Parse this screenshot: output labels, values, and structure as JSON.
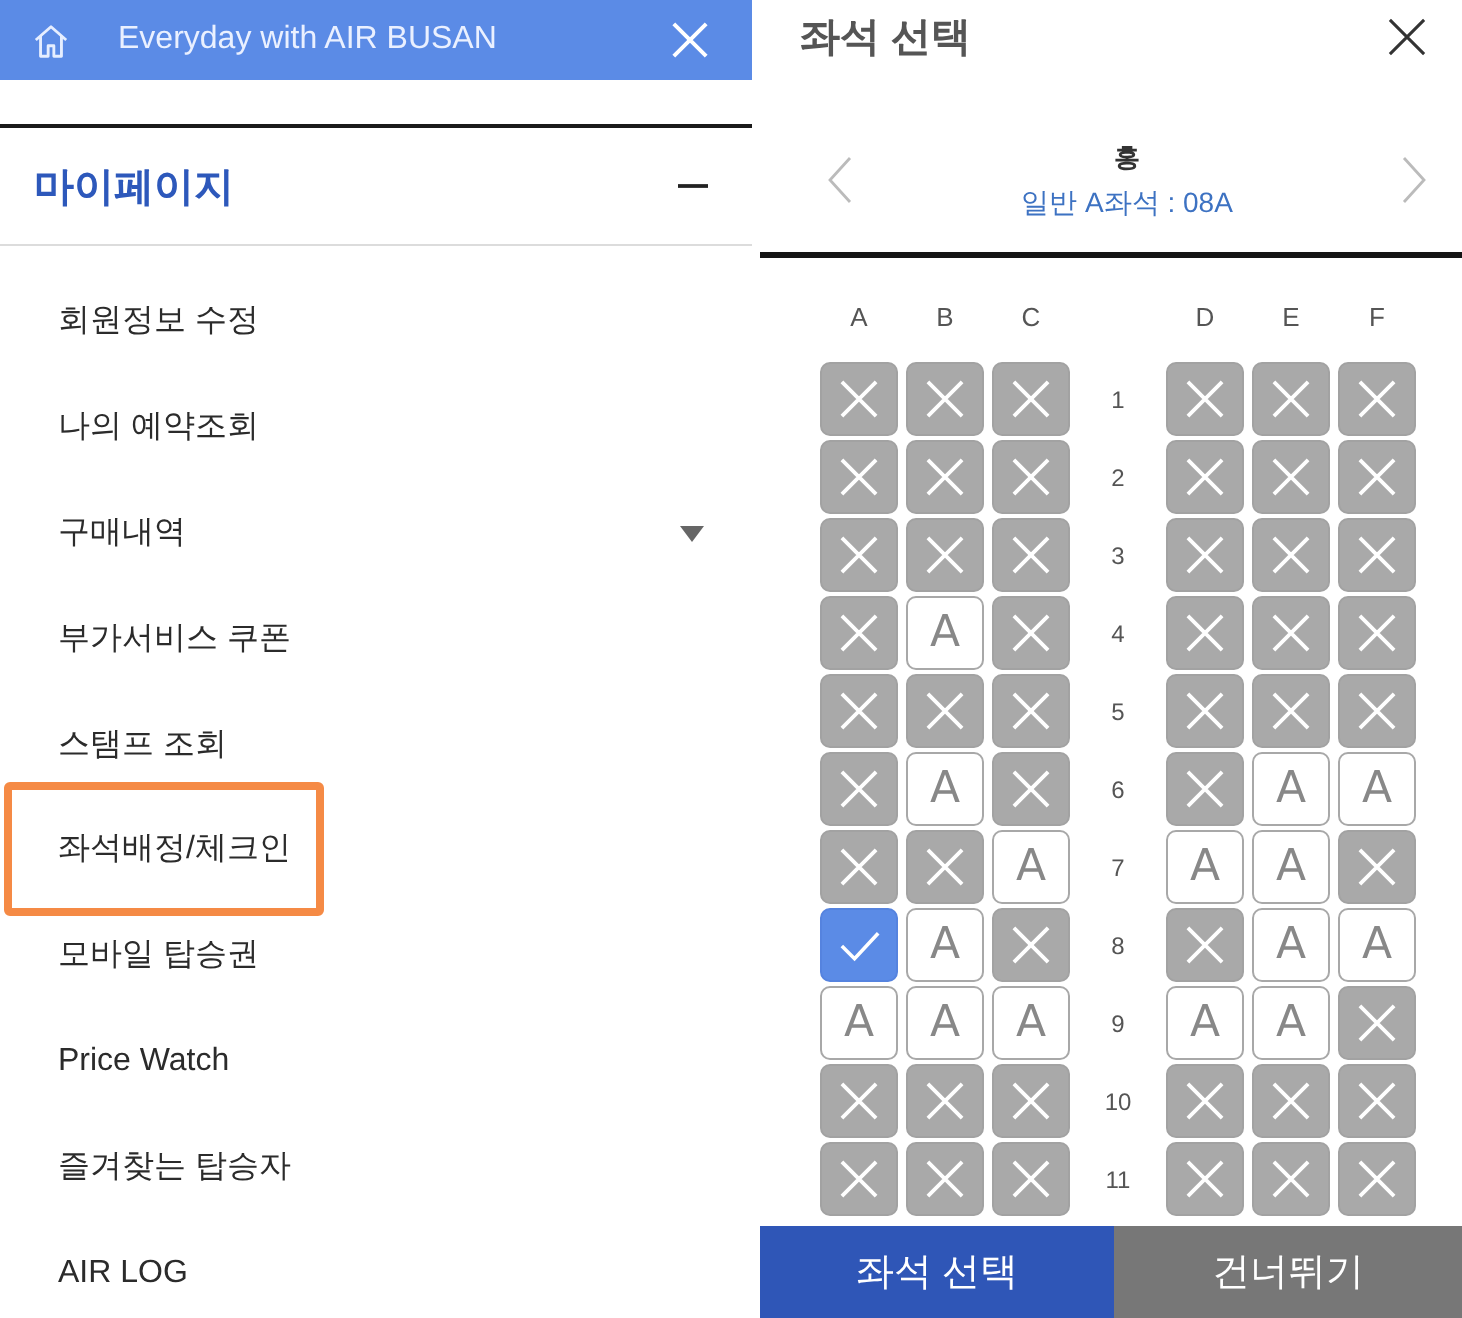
{
  "menu_header": {
    "title": "Everyday with AIR BUSAN"
  },
  "section": {
    "title": "마이페이지",
    "expanded": true,
    "items": [
      {
        "label": "회원정보 수정",
        "expandable": false,
        "highlighted": false
      },
      {
        "label": "나의 예약조회",
        "expandable": false,
        "highlighted": false
      },
      {
        "label": "구매내역",
        "expandable": true,
        "highlighted": false
      },
      {
        "label": "부가서비스 쿠폰",
        "expandable": false,
        "highlighted": false
      },
      {
        "label": "스탬프 조회",
        "expandable": false,
        "highlighted": false
      },
      {
        "label": "좌석배정/체크인",
        "expandable": false,
        "highlighted": true
      },
      {
        "label": "모바일 탑승권",
        "expandable": false,
        "highlighted": false
      },
      {
        "label": "Price Watch",
        "expandable": false,
        "highlighted": false
      },
      {
        "label": "즐겨찾는 탑승자",
        "expandable": false,
        "highlighted": false
      },
      {
        "label": "AIR LOG",
        "expandable": false,
        "highlighted": false
      }
    ]
  },
  "seat_dialog": {
    "title": "좌석 선택",
    "passenger": {
      "name": "홍",
      "seat_info": "일반 A좌석 : 08A"
    },
    "columns": {
      "left": [
        "A",
        "B",
        "C"
      ],
      "right": [
        "D",
        "E",
        "F"
      ]
    },
    "rows": [
      {
        "number": "1",
        "left": [
          {
            "occupied": true,
            "selected": false
          },
          {
            "occupied": true,
            "selected": false
          },
          {
            "occupied": true,
            "selected": false
          }
        ],
        "right": [
          {
            "occupied": true,
            "selected": false
          },
          {
            "occupied": true,
            "selected": false
          },
          {
            "occupied": true,
            "selected": false
          }
        ]
      },
      {
        "number": "2",
        "left": [
          {
            "occupied": true,
            "selected": false
          },
          {
            "occupied": true,
            "selected": false
          },
          {
            "occupied": true,
            "selected": false
          }
        ],
        "right": [
          {
            "occupied": true,
            "selected": false
          },
          {
            "occupied": true,
            "selected": false
          },
          {
            "occupied": true,
            "selected": false
          }
        ]
      },
      {
        "number": "3",
        "left": [
          {
            "occupied": true,
            "selected": false
          },
          {
            "occupied": true,
            "selected": false
          },
          {
            "occupied": true,
            "selected": false
          }
        ],
        "right": [
          {
            "occupied": true,
            "selected": false
          },
          {
            "occupied": true,
            "selected": false
          },
          {
            "occupied": true,
            "selected": false
          }
        ]
      },
      {
        "number": "4",
        "left": [
          {
            "occupied": true,
            "selected": false
          },
          {
            "label": "A",
            "occupied": false,
            "selected": false
          },
          {
            "occupied": true,
            "selected": false
          }
        ],
        "right": [
          {
            "occupied": true,
            "selected": false
          },
          {
            "occupied": true,
            "selected": false
          },
          {
            "occupied": true,
            "selected": false
          }
        ]
      },
      {
        "number": "5",
        "left": [
          {
            "occupied": true,
            "selected": false
          },
          {
            "occupied": true,
            "selected": false
          },
          {
            "occupied": true,
            "selected": false
          }
        ],
        "right": [
          {
            "occupied": true,
            "selected": false
          },
          {
            "occupied": true,
            "selected": false
          },
          {
            "occupied": true,
            "selected": false
          }
        ]
      },
      {
        "number": "6",
        "left": [
          {
            "occupied": true,
            "selected": false
          },
          {
            "label": "A",
            "occupied": false,
            "selected": false
          },
          {
            "occupied": true,
            "selected": false
          }
        ],
        "right": [
          {
            "occupied": true,
            "selected": false
          },
          {
            "label": "A",
            "occupied": false,
            "selected": false
          },
          {
            "label": "A",
            "occupied": false,
            "selected": false
          }
        ]
      },
      {
        "number": "7",
        "left": [
          {
            "occupied": true,
            "selected": false
          },
          {
            "occupied": true,
            "selected": false
          },
          {
            "label": "A",
            "occupied": false,
            "selected": false
          }
        ],
        "right": [
          {
            "label": "A",
            "occupied": false,
            "selected": false
          },
          {
            "label": "A",
            "occupied": false,
            "selected": false
          },
          {
            "occupied": true,
            "selected": false
          }
        ]
      },
      {
        "number": "8",
        "left": [
          {
            "occupied": false,
            "selected": true
          },
          {
            "label": "A",
            "occupied": false,
            "selected": false
          },
          {
            "occupied": true,
            "selected": false
          }
        ],
        "right": [
          {
            "occupied": true,
            "selected": false
          },
          {
            "label": "A",
            "occupied": false,
            "selected": false
          },
          {
            "label": "A",
            "occupied": false,
            "selected": false
          }
        ]
      },
      {
        "number": "9",
        "left": [
          {
            "label": "A",
            "occupied": false,
            "selected": false
          },
          {
            "label": "A",
            "occupied": false,
            "selected": false
          },
          {
            "label": "A",
            "occupied": false,
            "selected": false
          }
        ],
        "right": [
          {
            "label": "A",
            "occupied": false,
            "selected": false
          },
          {
            "label": "A",
            "occupied": false,
            "selected": false
          },
          {
            "occupied": true,
            "selected": false
          }
        ]
      },
      {
        "number": "10",
        "left": [
          {
            "occupied": true,
            "selected": false
          },
          {
            "occupied": true,
            "selected": false
          },
          {
            "occupied": true,
            "selected": false
          }
        ],
        "right": [
          {
            "occupied": true,
            "selected": false
          },
          {
            "occupied": true,
            "selected": false
          },
          {
            "occupied": true,
            "selected": false
          }
        ]
      },
      {
        "number": "11",
        "left": [
          {
            "occupied": true,
            "selected": false
          },
          {
            "occupied": true,
            "selected": false
          },
          {
            "occupied": true,
            "selected": false
          }
        ],
        "right": [
          {
            "occupied": true,
            "selected": false
          },
          {
            "occupied": true,
            "selected": false
          },
          {
            "occupied": true,
            "selected": false
          }
        ]
      }
    ],
    "buttons": [
      {
        "label": "좌석 선택",
        "kind": "primary"
      },
      {
        "label": "건너뛰기",
        "kind": "secondary"
      }
    ]
  }
}
